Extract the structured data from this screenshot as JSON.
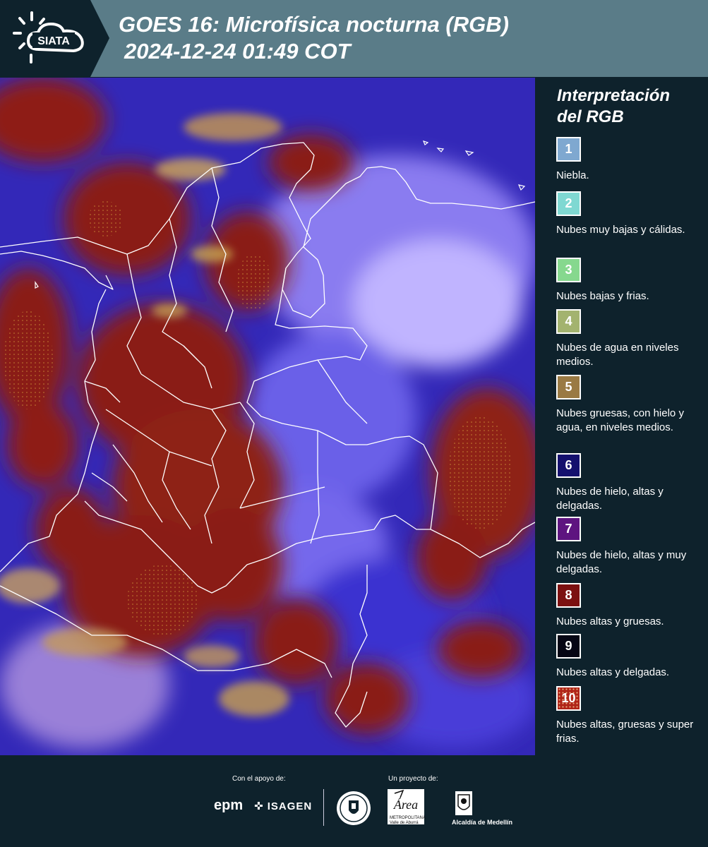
{
  "header": {
    "logo_text": "SIATA",
    "title_line1": "GOES 16: Microfísica nocturna (RGB)",
    "title_line2": "2024-12-24 01:49 COT"
  },
  "colors": {
    "header_bg": "#5a7c88",
    "panel_bg": "#0e222c",
    "borders": "#ffffff"
  },
  "legend": {
    "title": "Interpretación del RGB",
    "items": [
      {
        "num": "1",
        "label": "Niebla.",
        "color": "#7fa8d0"
      },
      {
        "num": "2",
        "label": "Nubes muy bajas y cálidas.",
        "color": "#7fd8d2"
      },
      {
        "num": "3",
        "label": "Nubes bajas y frias.",
        "color": "#86d88e"
      },
      {
        "num": "4",
        "label": "Nubes de agua en niveles medios.",
        "color": "#a3b36f"
      },
      {
        "num": "5",
        "label": "Nubes gruesas, con hielo y agua, en niveles medios.",
        "color": "#9a7a44"
      },
      {
        "num": "6",
        "label": "Nubes de hielo, altas y delgadas.",
        "color": "#14106e"
      },
      {
        "num": "7",
        "label": "Nubes de hielo, altas y muy delgadas.",
        "color": "#5e1480"
      },
      {
        "num": "8",
        "label": "Nubes altas y gruesas.",
        "color": "#7c1010"
      },
      {
        "num": "9",
        "label": "Nubes altas y delgadas.",
        "color": "#060614"
      },
      {
        "num": "10",
        "label": "Nubes altas, gruesas y super frias.",
        "color": "#b02418"
      }
    ]
  },
  "footer": {
    "support_label": "Con el apoyo de:",
    "project_label": "Un proyecto de:",
    "sponsor1": "epm",
    "sponsor2": "ISAGEN",
    "partner_area": "Área",
    "partner_area_sub": "METROPOLITANA Valle de Aburrá",
    "partner_medellin": "Alcaldía de Medellín"
  }
}
